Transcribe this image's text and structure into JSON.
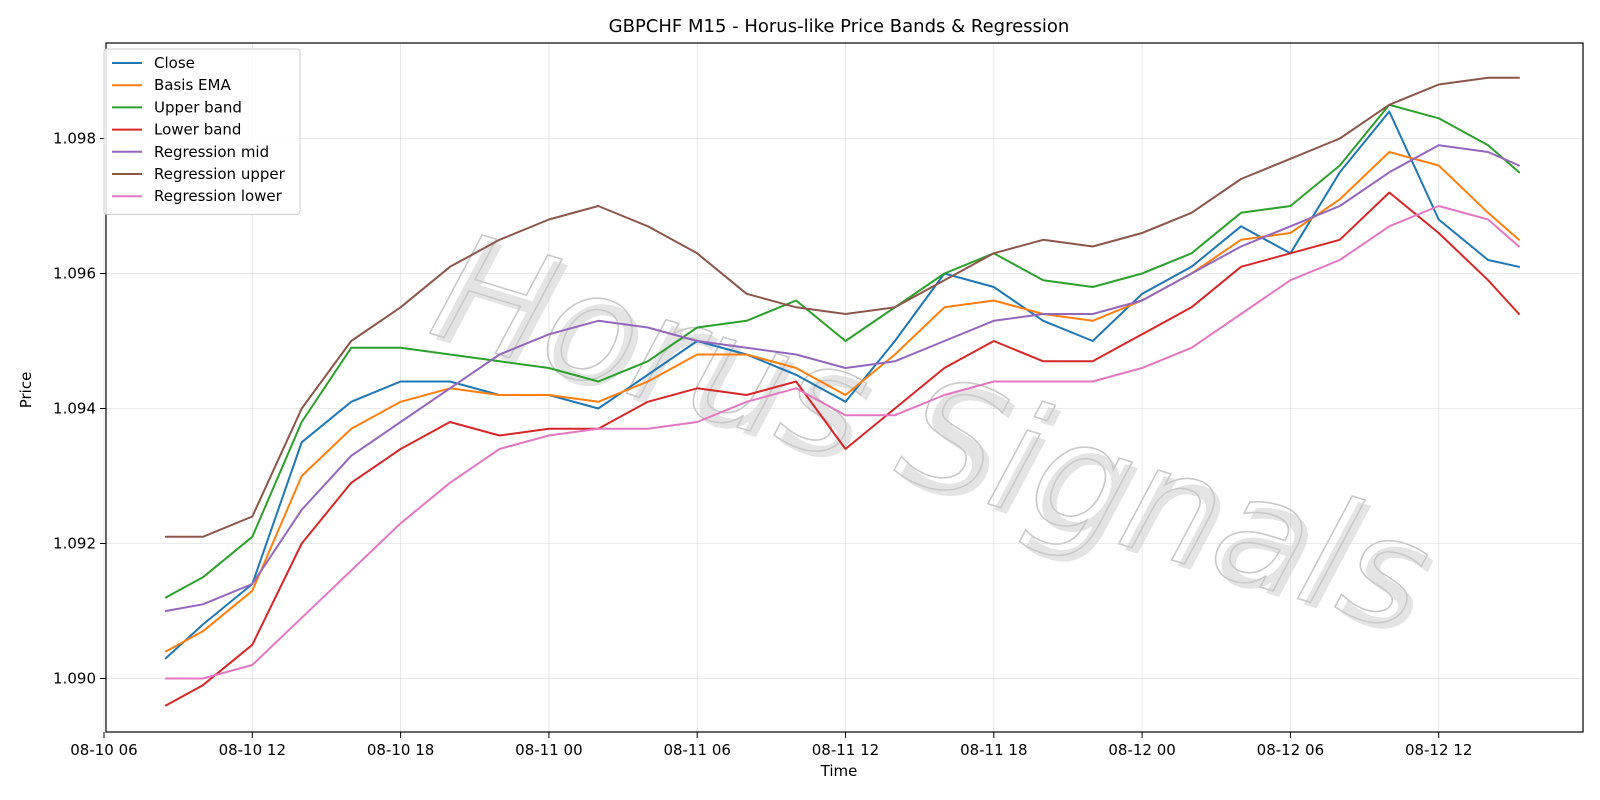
{
  "chart_data": {
    "type": "line",
    "title": "GBPCHF M15 - Horus-like Price Bands & Regression",
    "xlabel": "Time",
    "ylabel": "Price",
    "watermark": "Horus Signals",
    "x_ticks": [
      "08-10 06",
      "08-10 12",
      "08-10 18",
      "08-11 00",
      "08-11 06",
      "08-11 12",
      "08-11 18",
      "08-12 00",
      "08-12 06",
      "08-12 12"
    ],
    "y_ticks": [
      "1.090",
      "1.092",
      "1.094",
      "1.096",
      "1.098"
    ],
    "x_range": [
      "08-10 05:00",
      "08-12 22:00"
    ],
    "ylim": [
      1.0893,
      1.0894
    ],
    "grid": true,
    "legend_position": "top-left",
    "x": [
      "08-10 08:30",
      "08-10 10:00",
      "08-10 12:00",
      "08-10 14:00",
      "08-10 16:00",
      "08-10 18:00",
      "08-10 20:00",
      "08-10 22:00",
      "08-11 00:00",
      "08-11 02:00",
      "08-11 04:00",
      "08-11 06:00",
      "08-11 08:00",
      "08-11 10:00",
      "08-11 12:00",
      "08-11 14:00",
      "08-11 16:00",
      "08-11 18:00",
      "08-11 20:00",
      "08-11 22:00",
      "08-12 00:00",
      "08-12 02:00",
      "08-12 04:00",
      "08-12 06:00",
      "08-12 08:00",
      "08-12 10:00",
      "08-12 12:00",
      "08-12 14:00",
      "08-12 15:15"
    ],
    "series": [
      {
        "name": "Close",
        "color": "#1f77b4",
        "values": [
          1.0903,
          1.0908,
          1.0914,
          1.0935,
          1.0941,
          1.0944,
          1.0944,
          1.0942,
          1.0942,
          1.094,
          1.0945,
          1.095,
          1.0948,
          1.0945,
          1.0941,
          1.095,
          1.096,
          1.0958,
          1.0953,
          1.095,
          1.0957,
          1.0961,
          1.0967,
          1.0963,
          1.0975,
          1.0984,
          1.0968,
          1.0962,
          1.0961
        ]
      },
      {
        "name": "Basis EMA",
        "color": "#ff7f0e",
        "values": [
          1.0904,
          1.0907,
          1.0913,
          1.093,
          1.0937,
          1.0941,
          1.0943,
          1.0942,
          1.0942,
          1.0941,
          1.0944,
          1.0948,
          1.0948,
          1.0946,
          1.0942,
          1.0948,
          1.0955,
          1.0956,
          1.0954,
          1.0953,
          1.0956,
          1.096,
          1.0965,
          1.0966,
          1.0971,
          1.0978,
          1.0976,
          1.0969,
          1.0965
        ]
      },
      {
        "name": "Upper band",
        "color": "#2ca02c",
        "values": [
          1.0912,
          1.0915,
          1.0921,
          1.0938,
          1.0949,
          1.0949,
          1.0948,
          1.0947,
          1.0946,
          1.0944,
          1.0947,
          1.0952,
          1.0953,
          1.0956,
          1.095,
          1.0955,
          1.096,
          1.0963,
          1.0959,
          1.0958,
          1.096,
          1.0963,
          1.0969,
          1.097,
          1.0976,
          1.0985,
          1.0983,
          1.0979,
          1.0975
        ]
      },
      {
        "name": "Lower band",
        "color": "#d62728",
        "values": [
          1.0896,
          1.0899,
          1.0905,
          1.092,
          1.0929,
          1.0934,
          1.0938,
          1.0936,
          1.0937,
          1.0937,
          1.0941,
          1.0943,
          1.0942,
          1.0944,
          1.0934,
          1.094,
          1.0946,
          1.095,
          1.0947,
          1.0947,
          1.0951,
          1.0955,
          1.0961,
          1.0963,
          1.0965,
          1.0972,
          1.0966,
          1.0959,
          1.0954
        ]
      },
      {
        "name": "Regression mid",
        "color": "#9467bd",
        "values": [
          1.091,
          1.0911,
          1.0914,
          1.0925,
          1.0933,
          1.0938,
          1.0943,
          1.0948,
          1.0951,
          1.0953,
          1.0952,
          1.095,
          1.0949,
          1.0948,
          1.0946,
          1.0947,
          1.095,
          1.0953,
          1.0954,
          1.0954,
          1.0956,
          1.096,
          1.0964,
          1.0967,
          1.097,
          1.0975,
          1.0979,
          1.0978,
          1.0976
        ]
      },
      {
        "name": "Regression upper",
        "color": "#8c564b",
        "values": [
          1.0921,
          1.0921,
          1.0924,
          1.094,
          1.095,
          1.0955,
          1.0961,
          1.0965,
          1.0968,
          1.097,
          1.0967,
          1.0963,
          1.0957,
          1.0955,
          1.0954,
          1.0955,
          1.0959,
          1.0963,
          1.0965,
          1.0964,
          1.0966,
          1.0969,
          1.0974,
          1.0977,
          1.098,
          1.0985,
          1.0988,
          1.0989,
          1.0989
        ]
      },
      {
        "name": "Regression lower",
        "color": "#e377c2",
        "values": [
          1.09,
          1.09,
          1.0902,
          1.0909,
          1.0916,
          1.0923,
          1.0929,
          1.0934,
          1.0936,
          1.0937,
          1.0937,
          1.0938,
          1.0941,
          1.0943,
          1.0939,
          1.0939,
          1.0942,
          1.0944,
          1.0944,
          1.0944,
          1.0946,
          1.0949,
          1.0954,
          1.0959,
          1.0962,
          1.0967,
          1.097,
          1.0968,
          1.0964
        ]
      }
    ]
  }
}
